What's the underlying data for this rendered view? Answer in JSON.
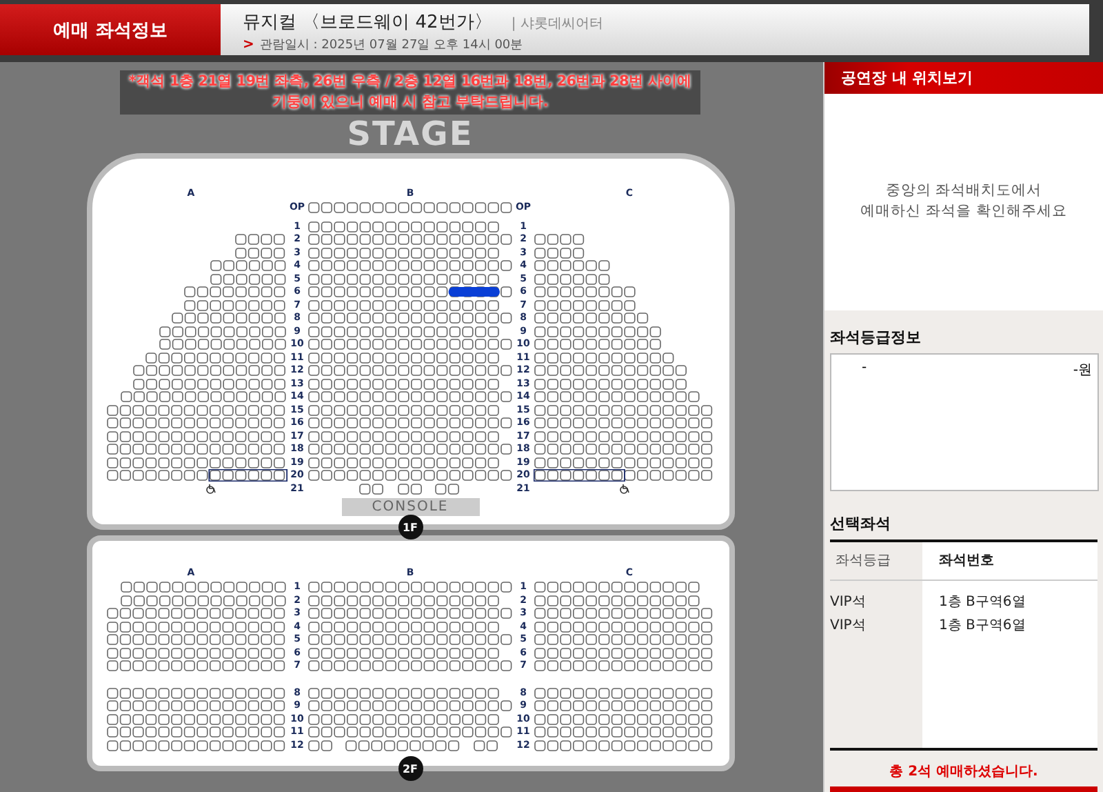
{
  "header": {
    "title": "예매 좌석정보"
  },
  "show": {
    "title": "뮤지컬 〈브로드웨이 42번가〉",
    "venue": "| 샤롯데씨어터",
    "date_mark": ">",
    "date": "관람일시 : 2025년 07월 27일 오후 14시 00분"
  },
  "notice": [
    "*객석 1층 21열 19번 좌측, 26번 우측 / 2층 12열 16번과 18번, 26번과 28번 사이에",
    "기둥이 있으니 예매 시 참고 부탁드립니다."
  ],
  "stage": "STAGE",
  "floors": [
    {
      "badge": "1F",
      "sections": [
        "A",
        "B",
        "C"
      ],
      "op_labels": [
        "OP",
        "OP"
      ],
      "console": "CONSOLE",
      "rows": [
        {
          "kind": "full",
          "left_label": "1",
          "right_label": "1",
          "selected_seats": false,
          "wheelchair_area": false
        },
        {
          "kind": "full",
          "left_label": "2",
          "right_label": "2",
          "selected_seats": false,
          "wheelchair_area": false
        },
        {
          "kind": "full",
          "left_label": "3",
          "right_label": "3",
          "selected_seats": false,
          "wheelchair_area": false
        },
        {
          "kind": "full",
          "left_label": "4",
          "right_label": "4",
          "selected_seats": false,
          "wheelchair_area": false
        },
        {
          "kind": "full",
          "left_label": "5",
          "right_label": "5",
          "selected_seats": false,
          "wheelchair_area": false
        },
        {
          "kind": "full",
          "left_label": "6",
          "right_label": "6",
          "selected_seats": true,
          "wheelchair_area": false
        },
        {
          "kind": "full",
          "left_label": "7",
          "right_label": "7",
          "selected_seats": false,
          "wheelchair_area": false
        },
        {
          "kind": "full",
          "left_label": "8",
          "right_label": "8",
          "selected_seats": false,
          "wheelchair_area": false
        },
        {
          "kind": "full",
          "left_label": "9",
          "right_label": "9",
          "selected_seats": false,
          "wheelchair_area": false
        },
        {
          "kind": "full",
          "left_label": "10",
          "right_label": "10",
          "selected_seats": false,
          "wheelchair_area": false
        },
        {
          "kind": "full",
          "left_label": "11",
          "right_label": "11",
          "selected_seats": false,
          "wheelchair_area": false
        },
        {
          "kind": "full",
          "left_label": "12",
          "right_label": "12",
          "selected_seats": false,
          "wheelchair_area": false
        },
        {
          "kind": "full",
          "left_label": "13",
          "right_label": "13",
          "selected_seats": false,
          "wheelchair_area": false
        },
        {
          "kind": "full",
          "left_label": "14",
          "right_label": "14",
          "selected_seats": false,
          "wheelchair_area": false
        },
        {
          "kind": "full",
          "left_label": "15",
          "right_label": "15",
          "selected_seats": false,
          "wheelchair_area": false
        },
        {
          "kind": "full",
          "left_label": "16",
          "right_label": "16",
          "selected_seats": false,
          "wheelchair_area": false
        },
        {
          "kind": "full",
          "left_label": "17",
          "right_label": "17",
          "selected_seats": false,
          "wheelchair_area": false
        },
        {
          "kind": "full",
          "left_label": "18",
          "right_label": "18",
          "selected_seats": false,
          "wheelchair_area": false
        },
        {
          "kind": "full",
          "left_label": "19",
          "right_label": "19",
          "selected_seats": false,
          "wheelchair_area": false
        },
        {
          "kind": "full",
          "left_label": "20",
          "right_label": "20",
          "selected_seats": false,
          "wheelchair_area": true
        },
        {
          "kind": "console",
          "left_label": "21",
          "right_label": "21",
          "selected_seats": false,
          "wheelchair_area": false
        }
      ]
    },
    {
      "badge": "2F",
      "sections": [
        "A",
        "B",
        "C"
      ],
      "rows": [
        {
          "kind": "full",
          "left_label": "1",
          "right_label": "1",
          "selected_seats": false,
          "wheelchair_area": false
        },
        {
          "kind": "full",
          "left_label": "2",
          "right_label": "2",
          "selected_seats": false,
          "wheelchair_area": false
        },
        {
          "kind": "full",
          "left_label": "3",
          "right_label": "3",
          "selected_seats": false,
          "wheelchair_area": false
        },
        {
          "kind": "full",
          "left_label": "4",
          "right_label": "4",
          "selected_seats": false,
          "wheelchair_area": false
        },
        {
          "kind": "full",
          "left_label": "5",
          "right_label": "5",
          "selected_seats": false,
          "wheelchair_area": false
        },
        {
          "kind": "full",
          "left_label": "6",
          "right_label": "6",
          "selected_seats": false,
          "wheelchair_area": false
        },
        {
          "kind": "full",
          "left_label": "7",
          "right_label": "7",
          "selected_seats": false,
          "wheelchair_area": false
        },
        {
          "kind": "aisle",
          "left_label": "8",
          "right_label": "8",
          "selected_seats": false,
          "wheelchair_area": false
        },
        {
          "kind": "full",
          "left_label": "9",
          "right_label": "9",
          "selected_seats": false,
          "wheelchair_area": false
        },
        {
          "kind": "full",
          "left_label": "10",
          "right_label": "10",
          "selected_seats": false,
          "wheelchair_area": false
        },
        {
          "kind": "full",
          "left_label": "11",
          "right_label": "11",
          "selected_seats": false,
          "wheelchair_area": false
        },
        {
          "kind": "pillar",
          "left_label": "12",
          "right_label": "12",
          "selected_seats": false,
          "wheelchair_area": false
        }
      ]
    }
  ],
  "side": {
    "title": "공연장 내 위치보기",
    "hint": [
      "중앙의 좌석배치도에서",
      "예매하신 좌석을 확인해주세요"
    ],
    "grade_info": {
      "title": "좌석등급정보",
      "grade": "-",
      "price": "-원"
    },
    "selected": {
      "title": "선택좌석",
      "columns": [
        "좌석등급",
        "좌석번호"
      ],
      "rows": [
        [
          "VIP석",
          "1층 B구역6열"
        ],
        [
          "VIP석",
          "1층 B구역6열"
        ]
      ]
    },
    "summary": "총 2석 예매하셨습니다."
  }
}
